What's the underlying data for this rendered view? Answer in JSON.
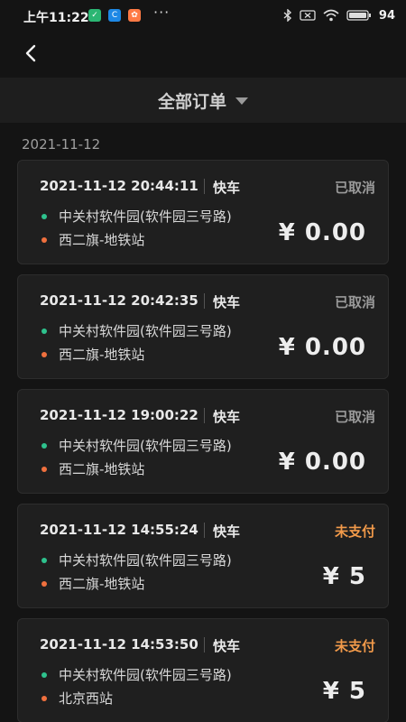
{
  "status_bar": {
    "time": "上午11:22",
    "battery": "94",
    "colors": {
      "app1": "#2bb673",
      "app2": "#1e88e5",
      "app3": "#ff7a45"
    }
  },
  "header": {
    "back_icon": "chevron-left-icon",
    "title": "全部订单",
    "dropdown_icon": "caret-down-icon"
  },
  "date_group": "2021-11-12",
  "orders": [
    {
      "time": "2021-11-12 20:44:11",
      "type": "快车",
      "status": "已取消",
      "status_kind": "cancel",
      "start": "中关村软件园(软件园三号路)",
      "end": "西二旗-地铁站",
      "price": "¥ 0.00"
    },
    {
      "time": "2021-11-12 20:42:35",
      "type": "快车",
      "status": "已取消",
      "status_kind": "cancel",
      "start": "中关村软件园(软件园三号路)",
      "end": "西二旗-地铁站",
      "price": "¥ 0.00"
    },
    {
      "time": "2021-11-12 19:00:22",
      "type": "快车",
      "status": "已取消",
      "status_kind": "cancel",
      "start": "中关村软件园(软件园三号路)",
      "end": "西二旗-地铁站",
      "price": "¥ 0.00"
    },
    {
      "time": "2021-11-12 14:55:24",
      "type": "快车",
      "status": "未支付",
      "status_kind": "unpaid",
      "start": "中关村软件园(软件园三号路)",
      "end": "西二旗-地铁站",
      "price": "¥ 5"
    },
    {
      "time": "2021-11-12 14:53:50",
      "type": "快车",
      "status": "未支付",
      "status_kind": "unpaid",
      "start": "中关村软件园(软件园三号路)",
      "end": "北京西站",
      "price": "¥ 5"
    }
  ],
  "theme": {
    "cancel_color": "#9a9a9a",
    "unpaid_color": "#f29a4a",
    "start_dot": "#2ec28d",
    "end_dot": "#f0703e"
  }
}
